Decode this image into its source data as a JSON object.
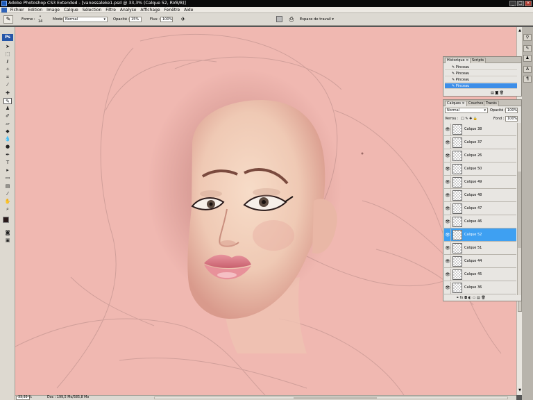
{
  "window": {
    "title": "Adobe Photoshop CS3 Extended - [vanessaleke1.psd @ 33,3% (Calque 52, RVB/8)]",
    "controls": [
      "_",
      "□",
      "×"
    ]
  },
  "menu": {
    "items": [
      "Fichier",
      "Edition",
      "Image",
      "Calque",
      "Sélection",
      "Filtre",
      "Analyse",
      "Affichage",
      "Fenêtre",
      "Aide"
    ]
  },
  "options": {
    "forme_label": "Forme :",
    "brush_size": "14",
    "mode_label": "Mode :",
    "mode_value": "Normal",
    "opacite_label": "Opacité :",
    "opacite_value": "15%",
    "flux_label": "Flux :",
    "flux_value": "100%",
    "workspace_label": "Espace de travail"
  },
  "toolbox": {
    "logo": "Ps"
  },
  "history_panel": {
    "tabs": [
      "Historique",
      "Scripts"
    ],
    "items": [
      {
        "label": "Pinceau",
        "selected": false
      },
      {
        "label": "Pinceau",
        "selected": false
      },
      {
        "label": "Pinceau",
        "selected": false
      },
      {
        "label": "Pinceau",
        "selected": true
      }
    ]
  },
  "layers_panel": {
    "tabs": [
      "Calques",
      "Couches",
      "Tracés"
    ],
    "blend_mode": "Normal",
    "opacity_label": "Opacité :",
    "opacity_value": "100%",
    "lock_label": "Verrou :",
    "fill_label": "Fond :",
    "fill_value": "100%",
    "layers": [
      {
        "name": "Calque 38",
        "selected": false
      },
      {
        "name": "Calque 37",
        "selected": false
      },
      {
        "name": "Calque 26",
        "selected": false
      },
      {
        "name": "Calque 50",
        "selected": false
      },
      {
        "name": "Calque 49",
        "selected": false
      },
      {
        "name": "Calque 48",
        "selected": false
      },
      {
        "name": "Calque 47",
        "selected": false
      },
      {
        "name": "Calque 46",
        "selected": false
      },
      {
        "name": "Calque 52",
        "selected": true
      },
      {
        "name": "Calque 51",
        "selected": false
      },
      {
        "name": "Calque 44",
        "selected": false
      },
      {
        "name": "Calque 45",
        "selected": false
      },
      {
        "name": "Calque 36",
        "selected": false
      }
    ]
  },
  "status": {
    "zoom": "33,33 %",
    "doc": "Doc : 199,5 Mo/585,8 Mo"
  },
  "colors": {
    "canvas": "#f0b8b1",
    "selection": "#3ea0f2",
    "titlebar": "#0b0b0b"
  }
}
